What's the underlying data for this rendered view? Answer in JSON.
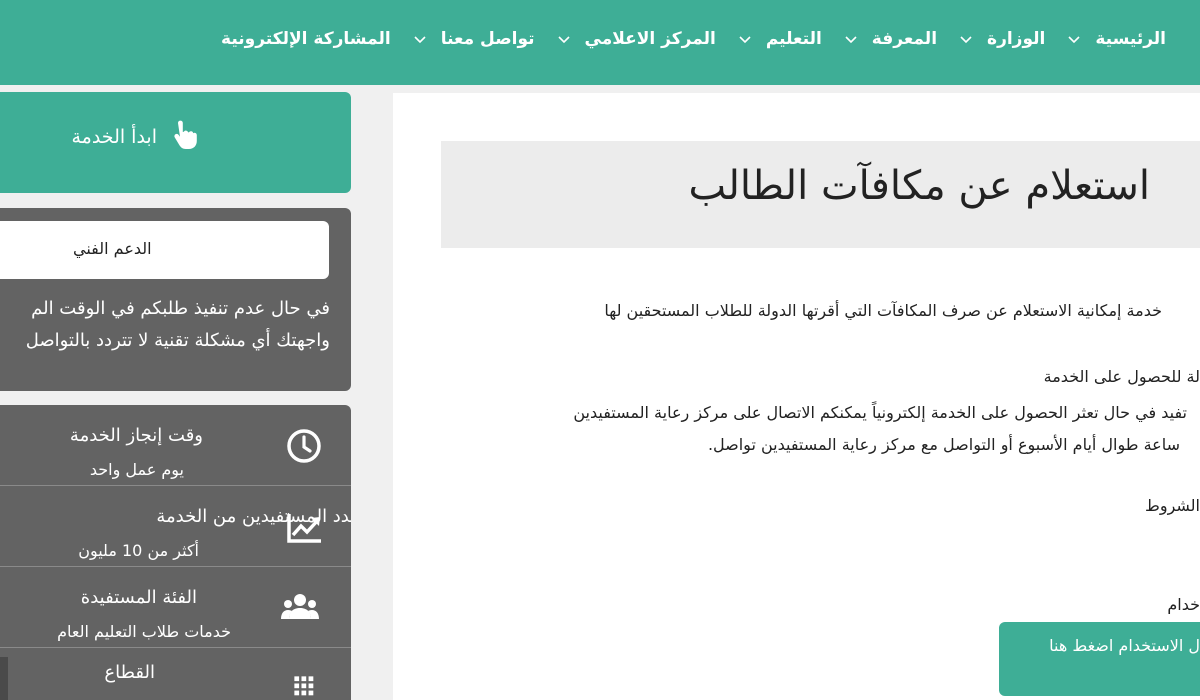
{
  "nav": {
    "items": [
      {
        "label": "الرئيسية",
        "has_dropdown": false
      },
      {
        "label": "الوزارة",
        "has_dropdown": true
      },
      {
        "label": "المعرفة",
        "has_dropdown": true
      },
      {
        "label": "التعليم",
        "has_dropdown": true
      },
      {
        "label": "المركز الاعلامي",
        "has_dropdown": true
      },
      {
        "label": "تواصل معنا",
        "has_dropdown": true
      },
      {
        "label": "المشاركة الإلكترونية",
        "has_dropdown": true
      }
    ]
  },
  "sidebar": {
    "start_button": {
      "label": "ابدأ الخدمة",
      "icon": "hand-pointer-icon"
    },
    "support": {
      "button_label": "الدعم الفني",
      "line1": "في حال عدم تنفيذ طلبكم في الوقت الم",
      "line2": "واجهتك أي مشكلة تقنية لا تتردد بالتواصل"
    },
    "info": [
      {
        "title": "وقت إنجاز الخدمة",
        "value": "يوم عمل واحد",
        "icon": "clock-icon"
      },
      {
        "title": "عدد المستفيدين من الخدمة",
        "value": "أكثر من 10 مليون",
        "icon": "chart-trend-icon"
      },
      {
        "title": "الفئة المستفيدة",
        "value": "خدمات طلاب التعليم العام",
        "icon": "users-icon"
      },
      {
        "title": "القطاع",
        "value": "",
        "icon": "grid-icon"
      }
    ]
  },
  "main": {
    "title": "استعلام عن مكافآت الطالب",
    "paragraphs": [
      "خدمة إمكانية الاستعلام عن صرف المكافآت التي أقرتها الدولة للطلاب المستحقين لها",
      "لة للحصول على الخدمة",
      "تفيد في حال تعثر الحصول على الخدمة إلكترونياً يمكنكم الاتصال على مركز رعاية المستفيدين",
      "ساعة طوال أيام الأسبوع أو التواصل مع مركز رعاية المستفيدين تواصل.",
      "الشروط",
      "خدام"
    ],
    "help_button": "ل الاستخدام اضغط هنا"
  },
  "colors": {
    "brand": "#3eae96",
    "panel": "#636363"
  }
}
